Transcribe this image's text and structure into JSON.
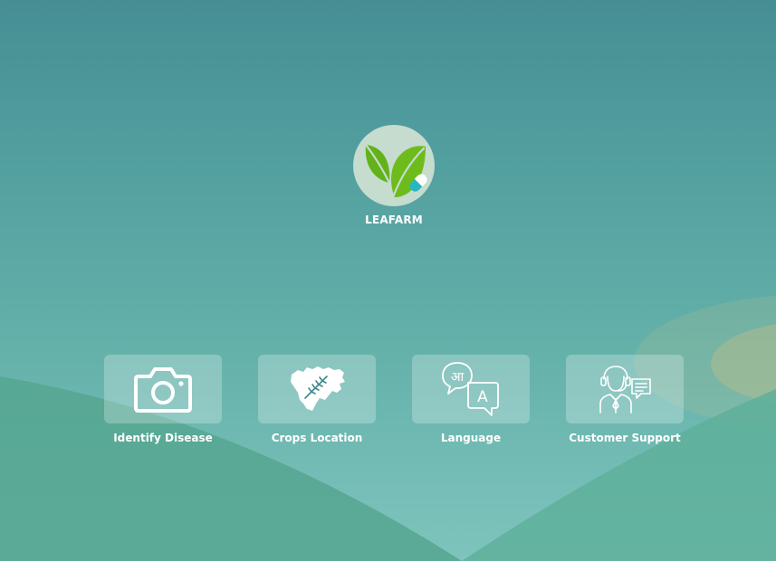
{
  "app": {
    "brand_name": "LEAFARM",
    "logo_icon": "leaf-capsule-icon"
  },
  "menu": [
    {
      "label": "Identify Disease",
      "icon": "camera-icon"
    },
    {
      "label": "Crops Location",
      "icon": "state-map-wheat-icon"
    },
    {
      "label": "Language",
      "icon": "language-translate-icon"
    },
    {
      "label": "Customer Support",
      "icon": "support-agent-icon"
    }
  ],
  "colors": {
    "background_top": "#468e94",
    "background_bottom": "#7ec4bd",
    "hill_green": "#55a690",
    "logo_circle": "#c5dccf",
    "leaf_green": "#63b21a",
    "tile_background": "rgba(255,255,255,0.25)",
    "text": "#ffffff"
  }
}
